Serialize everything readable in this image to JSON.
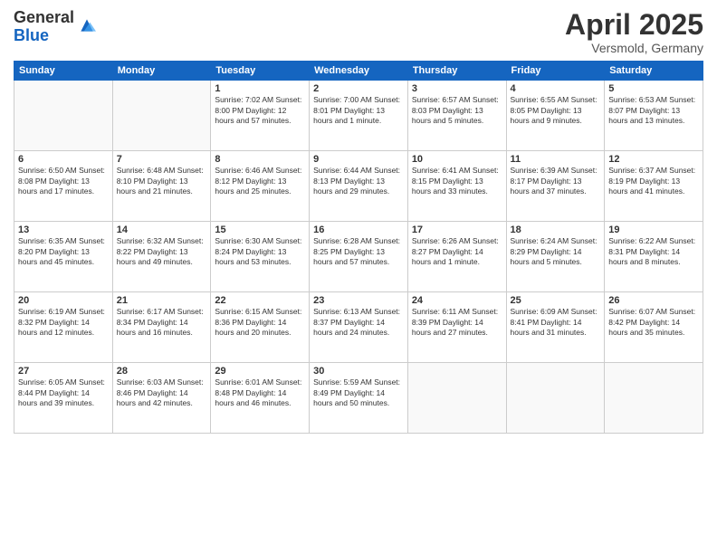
{
  "logo": {
    "general": "General",
    "blue": "Blue"
  },
  "title": "April 2025",
  "subtitle": "Versmold, Germany",
  "days_of_week": [
    "Sunday",
    "Monday",
    "Tuesday",
    "Wednesday",
    "Thursday",
    "Friday",
    "Saturday"
  ],
  "weeks": [
    [
      {
        "day": "",
        "info": ""
      },
      {
        "day": "",
        "info": ""
      },
      {
        "day": "1",
        "info": "Sunrise: 7:02 AM\nSunset: 8:00 PM\nDaylight: 12 hours and 57 minutes."
      },
      {
        "day": "2",
        "info": "Sunrise: 7:00 AM\nSunset: 8:01 PM\nDaylight: 13 hours and 1 minute."
      },
      {
        "day": "3",
        "info": "Sunrise: 6:57 AM\nSunset: 8:03 PM\nDaylight: 13 hours and 5 minutes."
      },
      {
        "day": "4",
        "info": "Sunrise: 6:55 AM\nSunset: 8:05 PM\nDaylight: 13 hours and 9 minutes."
      },
      {
        "day": "5",
        "info": "Sunrise: 6:53 AM\nSunset: 8:07 PM\nDaylight: 13 hours and 13 minutes."
      }
    ],
    [
      {
        "day": "6",
        "info": "Sunrise: 6:50 AM\nSunset: 8:08 PM\nDaylight: 13 hours and 17 minutes."
      },
      {
        "day": "7",
        "info": "Sunrise: 6:48 AM\nSunset: 8:10 PM\nDaylight: 13 hours and 21 minutes."
      },
      {
        "day": "8",
        "info": "Sunrise: 6:46 AM\nSunset: 8:12 PM\nDaylight: 13 hours and 25 minutes."
      },
      {
        "day": "9",
        "info": "Sunrise: 6:44 AM\nSunset: 8:13 PM\nDaylight: 13 hours and 29 minutes."
      },
      {
        "day": "10",
        "info": "Sunrise: 6:41 AM\nSunset: 8:15 PM\nDaylight: 13 hours and 33 minutes."
      },
      {
        "day": "11",
        "info": "Sunrise: 6:39 AM\nSunset: 8:17 PM\nDaylight: 13 hours and 37 minutes."
      },
      {
        "day": "12",
        "info": "Sunrise: 6:37 AM\nSunset: 8:19 PM\nDaylight: 13 hours and 41 minutes."
      }
    ],
    [
      {
        "day": "13",
        "info": "Sunrise: 6:35 AM\nSunset: 8:20 PM\nDaylight: 13 hours and 45 minutes."
      },
      {
        "day": "14",
        "info": "Sunrise: 6:32 AM\nSunset: 8:22 PM\nDaylight: 13 hours and 49 minutes."
      },
      {
        "day": "15",
        "info": "Sunrise: 6:30 AM\nSunset: 8:24 PM\nDaylight: 13 hours and 53 minutes."
      },
      {
        "day": "16",
        "info": "Sunrise: 6:28 AM\nSunset: 8:25 PM\nDaylight: 13 hours and 57 minutes."
      },
      {
        "day": "17",
        "info": "Sunrise: 6:26 AM\nSunset: 8:27 PM\nDaylight: 14 hours and 1 minute."
      },
      {
        "day": "18",
        "info": "Sunrise: 6:24 AM\nSunset: 8:29 PM\nDaylight: 14 hours and 5 minutes."
      },
      {
        "day": "19",
        "info": "Sunrise: 6:22 AM\nSunset: 8:31 PM\nDaylight: 14 hours and 8 minutes."
      }
    ],
    [
      {
        "day": "20",
        "info": "Sunrise: 6:19 AM\nSunset: 8:32 PM\nDaylight: 14 hours and 12 minutes."
      },
      {
        "day": "21",
        "info": "Sunrise: 6:17 AM\nSunset: 8:34 PM\nDaylight: 14 hours and 16 minutes."
      },
      {
        "day": "22",
        "info": "Sunrise: 6:15 AM\nSunset: 8:36 PM\nDaylight: 14 hours and 20 minutes."
      },
      {
        "day": "23",
        "info": "Sunrise: 6:13 AM\nSunset: 8:37 PM\nDaylight: 14 hours and 24 minutes."
      },
      {
        "day": "24",
        "info": "Sunrise: 6:11 AM\nSunset: 8:39 PM\nDaylight: 14 hours and 27 minutes."
      },
      {
        "day": "25",
        "info": "Sunrise: 6:09 AM\nSunset: 8:41 PM\nDaylight: 14 hours and 31 minutes."
      },
      {
        "day": "26",
        "info": "Sunrise: 6:07 AM\nSunset: 8:42 PM\nDaylight: 14 hours and 35 minutes."
      }
    ],
    [
      {
        "day": "27",
        "info": "Sunrise: 6:05 AM\nSunset: 8:44 PM\nDaylight: 14 hours and 39 minutes."
      },
      {
        "day": "28",
        "info": "Sunrise: 6:03 AM\nSunset: 8:46 PM\nDaylight: 14 hours and 42 minutes."
      },
      {
        "day": "29",
        "info": "Sunrise: 6:01 AM\nSunset: 8:48 PM\nDaylight: 14 hours and 46 minutes."
      },
      {
        "day": "30",
        "info": "Sunrise: 5:59 AM\nSunset: 8:49 PM\nDaylight: 14 hours and 50 minutes."
      },
      {
        "day": "",
        "info": ""
      },
      {
        "day": "",
        "info": ""
      },
      {
        "day": "",
        "info": ""
      }
    ]
  ]
}
